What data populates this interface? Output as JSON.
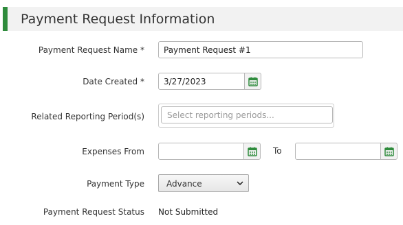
{
  "section": {
    "title": "Payment Request Information"
  },
  "fields": {
    "name": {
      "label": "Payment Request Name *",
      "value": "Payment Request #1"
    },
    "date_created": {
      "label": "Date Created *",
      "value": "3/27/2023"
    },
    "reporting_periods": {
      "label": "Related Reporting Period(s)",
      "placeholder": "Select reporting periods..."
    },
    "expenses": {
      "label": "Expenses From",
      "from_value": "",
      "to_label": "To",
      "to_value": ""
    },
    "payment_type": {
      "label": "Payment Type",
      "selected": "Advance"
    },
    "status": {
      "label": "Payment Request Status",
      "value": "Not Submitted"
    }
  },
  "icons": {
    "calendar": "calendar-icon",
    "chevron": "chevron-down-icon"
  },
  "colors": {
    "accent": "#2e8b3c",
    "header_bg": "#f2f2f2"
  }
}
